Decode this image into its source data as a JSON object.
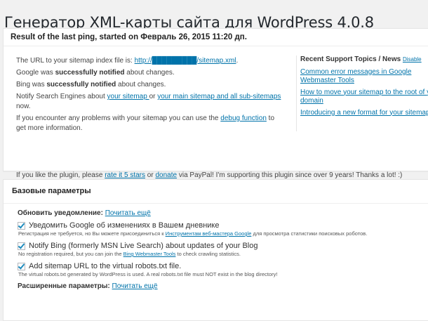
{
  "page": {
    "title": "Генератор XML-карты сайта для WordPress 4.0.8"
  },
  "ping_box": {
    "heading": "Result of the last ping, started on Февраль 26, 2015 11:20 дп.",
    "index_prefix": "The URL to your sitemap index file is: ",
    "index_url": "http://█████████/sitemap.xml",
    "index_suffix": ".",
    "google_prefix": "Google was ",
    "google_bold": "successfully notified",
    "google_suffix": " about changes.",
    "bing_prefix": "Bing was ",
    "bing_bold": "successfully notified",
    "bing_suffix": " about changes.",
    "notify_prefix": "Notify Search Engines about ",
    "notify_link1": "your sitemap ",
    "notify_mid": " or ",
    "notify_link2": "your main sitemap and all sub-sitemaps",
    "notify_suffix": " now.",
    "debug_prefix": "If you encounter any problems with your sitemap you can use the ",
    "debug_link": "debug function",
    "debug_suffix": " to get more information.",
    "like_prefix": "If you like the plugin, please ",
    "like_link1": "rate it 5 stars",
    "like_mid": " or ",
    "like_link2": "donate",
    "like_suffix": " via PayPal! I'm supporting this plugin since over 9 years! Thanks a lot! :)"
  },
  "news": {
    "heading": "Recent Support Topics / News ",
    "disable": "Disable",
    "items": [
      "Common error messages in Google Webmaster Tools",
      "How to move your sitemap to the root of your domain",
      "Introducing a new format for your sitemap"
    ]
  },
  "basic": {
    "heading": "Базовые параметры",
    "update_label": "Обновить уведомление: ",
    "read_more": "Почитать ещё",
    "options": [
      {
        "label": "Уведомить Google об изменениях в Вашем дневнике",
        "desc_prefix": "Регистрация не требуется, но Вы можете присоединиться к ",
        "desc_link": "Инструментам веб-мастера Google",
        "desc_suffix": " для просмотра статистики поисковых роботов.",
        "checked": true
      },
      {
        "label": "Notify Bing (formerly MSN Live Search) about updates of your Blog",
        "desc_prefix": "No registration required, but you can join the ",
        "desc_link": "Bing Webmaster Tools",
        "desc_suffix": " to check crawling statistics.",
        "checked": true
      },
      {
        "label": "Add sitemap URL to the virtual robots.txt file.",
        "desc_prefix": "The virtual robots.txt generated by WordPress is used. A real robots.txt file must NOT exist in the blog directory!",
        "desc_link": "",
        "desc_suffix": "",
        "checked": true
      }
    ],
    "advanced_label": "Расширенные параметры: ",
    "advanced_read_more": "Почитать ещё"
  },
  "colors": {
    "link": "#0073aa",
    "checkmark": "#1e8cbe",
    "background": "#f1f1f1"
  }
}
